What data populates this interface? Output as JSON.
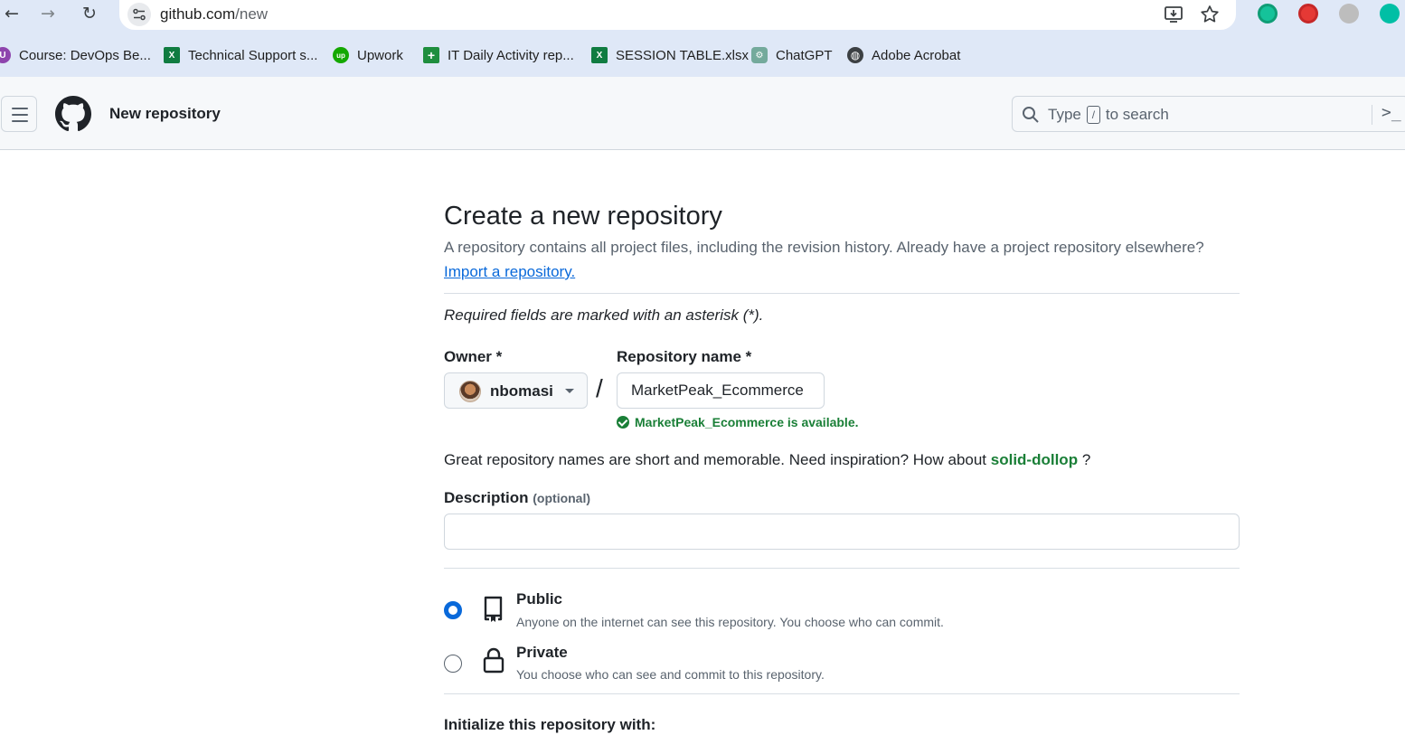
{
  "browser": {
    "url_domain": "github.com",
    "url_path": "/new",
    "bookmarks": [
      {
        "label": "Course: DevOps Be...",
        "icon": "course-icon",
        "color": "#8e44ad"
      },
      {
        "label": "Technical Support s...",
        "icon": "excel-icon",
        "color": "#107c41"
      },
      {
        "label": "Upwork",
        "icon": "upwork-icon",
        "color": "#14a800"
      },
      {
        "label": "IT Daily Activity rep...",
        "icon": "sheets-plus-icon",
        "color": "#1e8e3e"
      },
      {
        "label": "SESSION TABLE.xlsx",
        "icon": "excel-icon",
        "color": "#107c41"
      },
      {
        "label": "ChatGPT",
        "icon": "chatgpt-icon",
        "color": "#74aa9c"
      },
      {
        "label": "Adobe Acrobat",
        "icon": "globe-icon",
        "color": "#3c4043"
      }
    ]
  },
  "header": {
    "title": "New repository",
    "search_before": "Type",
    "search_key": "/",
    "search_after": "to search"
  },
  "page": {
    "title": "Create a new repository",
    "subtitle": "A repository contains all project files, including the revision history. Already have a project repository elsewhere?",
    "import_link": "Import a repository.",
    "required_note": "Required fields are marked with an asterisk (*).",
    "owner_label": "Owner *",
    "owner_value": "nbomasi",
    "repo_label": "Repository name *",
    "repo_value": "MarketPeak_Ecommerce",
    "availability": "MarketPeak_Ecommerce is available.",
    "inspire_text": "Great repository names are short and memorable. Need inspiration? How about",
    "inspire_suggestion": "solid-dollop",
    "inspire_end": "?",
    "description_label": "Description",
    "description_optional": "(optional)",
    "description_value": "",
    "visibility": [
      {
        "title": "Public",
        "desc": "Anyone on the internet can see this repository. You choose who can commit.",
        "selected": true
      },
      {
        "title": "Private",
        "desc": "You choose who can see and commit to this repository.",
        "selected": false
      }
    ],
    "init_label": "Initialize this repository with:"
  },
  "colors": {
    "accent": "#0969da",
    "success": "#1a7f37",
    "chrome_bg": "#dfe8f7"
  }
}
